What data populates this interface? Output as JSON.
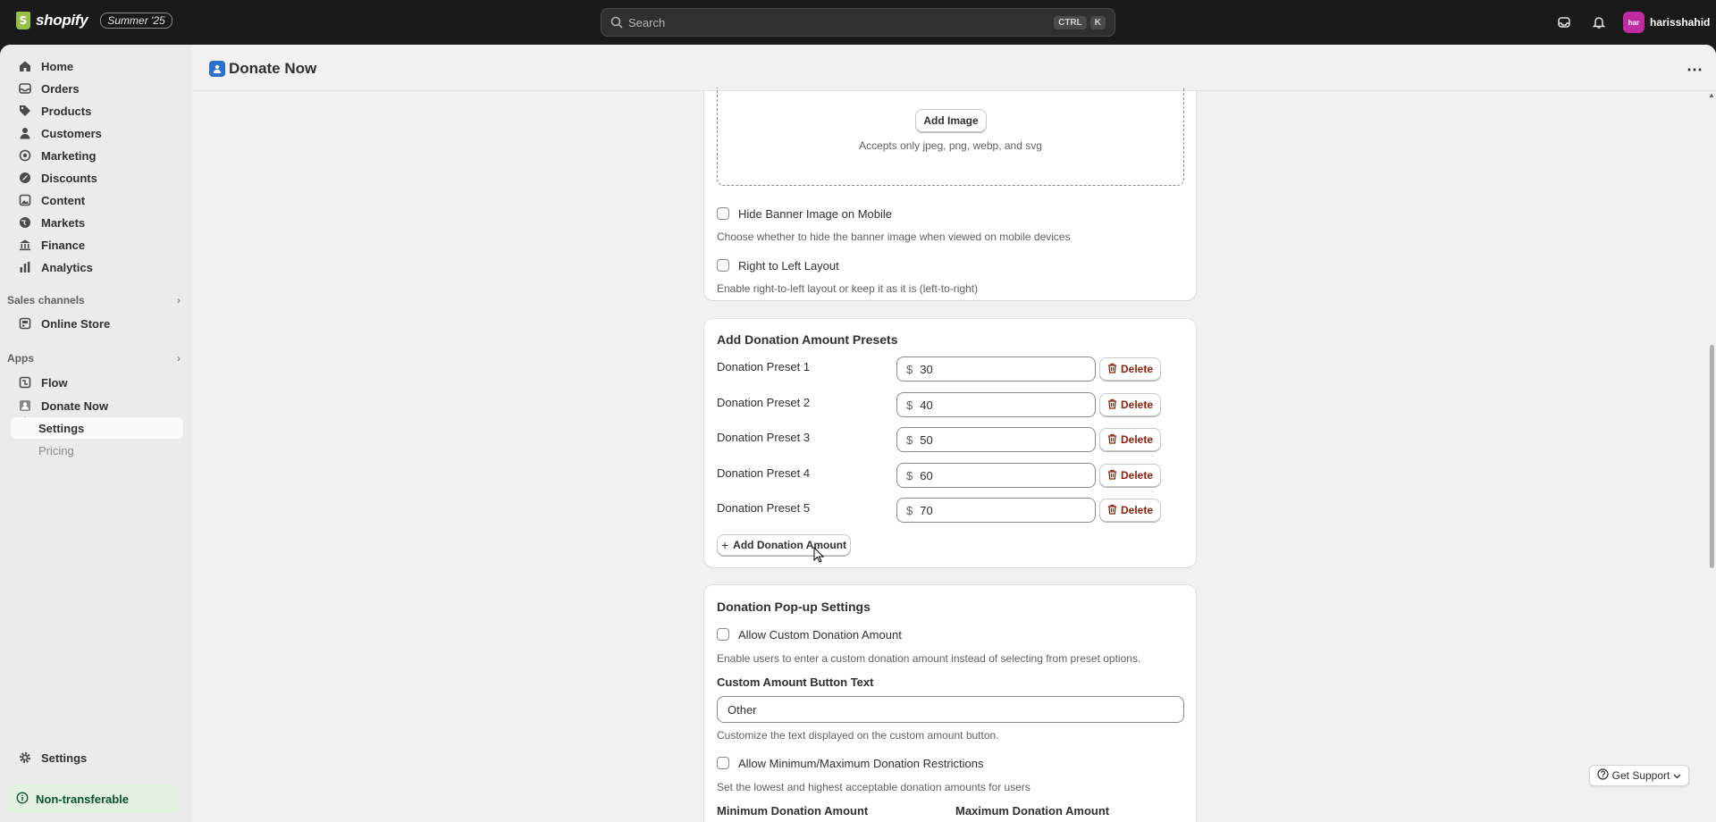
{
  "topbar": {
    "brand": "shopify",
    "edition": "Summer '25",
    "search_placeholder": "Search",
    "shortcut_1": "CTRL",
    "shortcut_2": "K",
    "user_initials": "har",
    "user_name": "harisshahid"
  },
  "sidebar": {
    "items": [
      {
        "label": "Home",
        "icon": "home-icon"
      },
      {
        "label": "Orders",
        "icon": "orders-icon"
      },
      {
        "label": "Products",
        "icon": "tag-icon"
      },
      {
        "label": "Customers",
        "icon": "person-icon"
      },
      {
        "label": "Marketing",
        "icon": "target-icon"
      },
      {
        "label": "Discounts",
        "icon": "discount-icon"
      },
      {
        "label": "Content",
        "icon": "content-icon"
      },
      {
        "label": "Markets",
        "icon": "globe-icon"
      },
      {
        "label": "Finance",
        "icon": "bank-icon"
      },
      {
        "label": "Analytics",
        "icon": "bar-chart-icon"
      }
    ],
    "sales_channels_title": "Sales channels",
    "online_store": "Online Store",
    "apps_title": "Apps",
    "flow": "Flow",
    "donate_now": "Donate Now",
    "settings_sub": "Settings",
    "pricing_sub": "Pricing",
    "settings": "Settings",
    "non_transferable": "Non-transferable"
  },
  "page": {
    "title": "Donate Now"
  },
  "banner_card": {
    "add_image": "Add Image",
    "accepts": "Accepts only jpeg, png, webp, and svg",
    "hide_banner_label": "Hide Banner Image on Mobile",
    "hide_banner_help": "Choose whether to hide the banner image when viewed on mobile devices",
    "rtl_label": "Right to Left Layout",
    "rtl_help": "Enable right-to-left layout or keep it as it is (left-to-right)"
  },
  "presets_card": {
    "title": "Add Donation Amount Presets",
    "currency": "$",
    "delete_label": "Delete",
    "presets": [
      {
        "label": "Donation Preset 1",
        "value": "30"
      },
      {
        "label": "Donation Preset 2",
        "value": "40"
      },
      {
        "label": "Donation Preset 3",
        "value": "50"
      },
      {
        "label": "Donation Preset 4",
        "value": "60"
      },
      {
        "label": "Donation Preset 5",
        "value": "70"
      }
    ],
    "add_label": "Add Donation Amount"
  },
  "popup_card": {
    "title": "Donation Pop-up Settings",
    "custom_amount_label": "Allow Custom Donation Amount",
    "custom_amount_help": "Enable users to enter a custom donation amount instead of selecting from preset options.",
    "button_text_label": "Custom Amount Button Text",
    "button_text_value": "Other",
    "button_text_help": "Customize the text displayed on the custom amount button.",
    "minmax_label": "Allow Minimum/Maximum Donation Restrictions",
    "minmax_help": "Set the lowest and highest acceptable donation amounts for users",
    "min_label": "Minimum Donation Amount",
    "max_label": "Maximum Donation Amount"
  },
  "support": {
    "label": "Get Support"
  },
  "colors": {
    "topbar": "#1a1a1a",
    "delete_text": "#8e1f0b",
    "app_icon": "#2c6ecb",
    "non_transfer_bg": "#e3f1df"
  }
}
